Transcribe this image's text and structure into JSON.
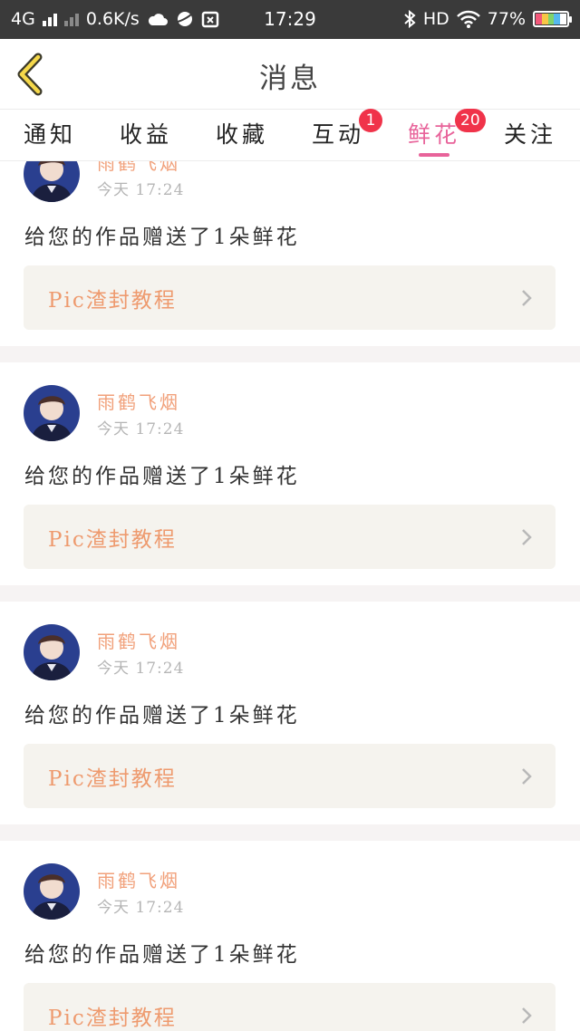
{
  "status_bar": {
    "network": "4G",
    "speed": "0.6K/s",
    "time": "17:29",
    "hd": "HD",
    "battery": "77%"
  },
  "header": {
    "title": "消息",
    "back_icon": "chevron-left-icon"
  },
  "tabs": [
    {
      "label": "通知",
      "badge": ""
    },
    {
      "label": "收益",
      "badge": ""
    },
    {
      "label": "收藏",
      "badge": ""
    },
    {
      "label": "互动",
      "badge": "1"
    },
    {
      "label": "鲜花",
      "badge": "20"
    },
    {
      "label": "关注",
      "badge": ""
    }
  ],
  "active_tab": "鲜花",
  "colors": {
    "accent": "#e8639a",
    "badge": "#f0334a",
    "username": "#f1a07a",
    "reference_text": "#ee9a6e"
  },
  "items": [
    {
      "user": "雨鹤飞烟",
      "time": "今天 17:24",
      "message": "给您的作品赠送了1朵鲜花",
      "work": "Pic渣封教程"
    },
    {
      "user": "雨鹤飞烟",
      "time": "今天 17:24",
      "message": "给您的作品赠送了1朵鲜花",
      "work": "Pic渣封教程"
    },
    {
      "user": "雨鹤飞烟",
      "time": "今天 17:24",
      "message": "给您的作品赠送了1朵鲜花",
      "work": "Pic渣封教程"
    },
    {
      "user": "雨鹤飞烟",
      "time": "今天 17:24",
      "message": "给您的作品赠送了1朵鲜花",
      "work": "Pic渣封教程"
    }
  ]
}
